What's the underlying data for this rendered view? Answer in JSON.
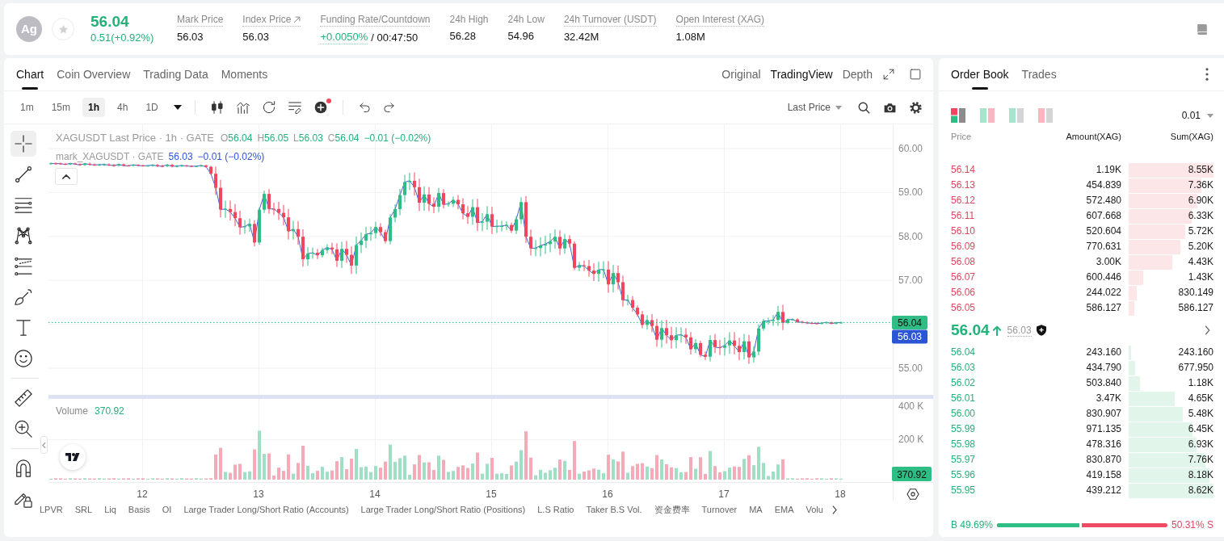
{
  "header": {
    "avatar": "Ag",
    "favorited": false,
    "last_price": "56.04",
    "change": "0.51(+0.92%)",
    "stats": [
      {
        "label": "Mark Price",
        "value": "56.03",
        "hint": true,
        "kind": "plain"
      },
      {
        "label": "Index Price",
        "value": "56.03",
        "hint": true,
        "kind": "link"
      },
      {
        "label": "Funding Rate/Countdown",
        "value": "+0.0050%",
        "extra": "/ 00:47:50",
        "hint": true,
        "kind": "funding"
      },
      {
        "label": "24h High",
        "value": "56.28",
        "hint": false,
        "kind": "plain"
      },
      {
        "label": "24h Low",
        "value": "54.96",
        "hint": false,
        "kind": "plain"
      },
      {
        "label": "24h Turnover (USDT)",
        "value": "32.42M",
        "hint": true,
        "kind": "plain"
      },
      {
        "label": "Open Interest (XAG)",
        "value": "1.08M",
        "hint": true,
        "kind": "plain"
      }
    ]
  },
  "chart_panel": {
    "tabs": [
      {
        "label": "Chart",
        "selected": true
      },
      {
        "label": "Coin Overview",
        "selected": false
      },
      {
        "label": "Trading Data",
        "selected": false
      },
      {
        "label": "Moments",
        "selected": false
      }
    ],
    "views": [
      {
        "label": "Original",
        "selected": false
      },
      {
        "label": "TradingView",
        "selected": true
      },
      {
        "label": "Depth",
        "selected": false
      }
    ],
    "intervals": [
      {
        "label": "1m",
        "selected": false
      },
      {
        "label": "15m",
        "selected": false
      },
      {
        "label": "1h",
        "selected": true
      },
      {
        "label": "4h",
        "selected": false
      },
      {
        "label": "1D",
        "selected": false
      }
    ],
    "indicator_dot": true,
    "price_source": "Last Price",
    "tool_groups": [
      {
        "tools": [
          {
            "kind": "crosshair",
            "selected": true
          },
          {
            "kind": "trend_line",
            "selected": false
          },
          {
            "kind": "parallel_lines",
            "selected": false
          },
          {
            "kind": "pattern",
            "selected": false
          },
          {
            "kind": "levels",
            "selected": false
          },
          {
            "kind": "brush",
            "selected": false
          },
          {
            "kind": "text",
            "selected": false
          },
          {
            "kind": "emoji",
            "selected": false
          }
        ]
      },
      {
        "tools": [
          {
            "kind": "ruler",
            "selected": false
          },
          {
            "kind": "zoom",
            "selected": false
          }
        ]
      },
      {
        "tools": [
          {
            "kind": "magnet",
            "selected": false
          },
          {
            "kind": "lock",
            "selected": false
          }
        ]
      }
    ],
    "legend": {
      "title": "XAGUSDT Last Price · 1h · GATE",
      "ohlc": [
        {
          "key": "O",
          "value": "56.04"
        },
        {
          "key": "H",
          "value": "56.05"
        },
        {
          "key": "L",
          "value": "56.03"
        },
        {
          "key": "C",
          "value": "56.04"
        }
      ],
      "change": "−0.01 (−0.02%)"
    },
    "mark_legend": {
      "title": "mark_XAGUSDT · GATE",
      "value": "56.03",
      "change": "−0.01 (−0.02%)"
    },
    "legend_expanded": true,
    "price_axis": [
      "60.00",
      "59.00",
      "58.00",
      "57.00",
      "55.00"
    ],
    "price_tags": [
      {
        "label": "56.04",
        "color": "#2ebd85"
      },
      {
        "label": "56.03",
        "color": "#2a55d5"
      }
    ],
    "volume_legend": {
      "title": "Volume",
      "value": "370.92"
    },
    "volume_axis": [
      "400 K",
      "200 K"
    ],
    "volume_tag": "370.92",
    "time_axis": [
      "12",
      "13",
      "14",
      "15",
      "16",
      "17",
      "18"
    ],
    "indicators": [
      "LPVR",
      "SRL",
      "Liq",
      "Basis",
      "OI",
      "Large Trader Long/Short Ratio (Accounts)",
      "Large Trader Long/Short Ratio (Positions)",
      "L.S Ratio",
      "Taker B.S Vol.",
      "资金费率",
      "Turnover",
      "MA",
      "EMA",
      "Volu"
    ]
  },
  "order_book": {
    "tabs": [
      {
        "label": "Order Book",
        "selected": true
      },
      {
        "label": "Trades",
        "selected": false
      }
    ],
    "layouts": [
      {
        "kind": "both",
        "selected": true
      },
      {
        "kind": "split",
        "selected": false
      },
      {
        "kind": "bids",
        "selected": false
      },
      {
        "kind": "asks",
        "selected": false
      }
    ],
    "precision": "0.01",
    "columns": [
      "Price",
      "Amount(XAG)",
      "Sum(XAG)"
    ],
    "asks": [
      {
        "price": "56.14",
        "amount": "1.19K",
        "sum": "8.55K"
      },
      {
        "price": "56.13",
        "amount": "454.839",
        "sum": "7.36K"
      },
      {
        "price": "56.12",
        "amount": "572.480",
        "sum": "6.90K"
      },
      {
        "price": "56.11",
        "amount": "607.668",
        "sum": "6.33K"
      },
      {
        "price": "56.10",
        "amount": "520.604",
        "sum": "5.72K"
      },
      {
        "price": "56.09",
        "amount": "770.631",
        "sum": "5.20K"
      },
      {
        "price": "56.08",
        "amount": "3.00K",
        "sum": "4.43K"
      },
      {
        "price": "56.07",
        "amount": "600.446",
        "sum": "1.43K"
      },
      {
        "price": "56.06",
        "amount": "244.022",
        "sum": "830.149"
      },
      {
        "price": "56.05",
        "amount": "586.127",
        "sum": "586.127"
      }
    ],
    "last": {
      "price": "56.04",
      "rising": true,
      "mark": "56.03"
    },
    "bids": [
      {
        "price": "56.04",
        "amount": "243.160",
        "sum": "243.160"
      },
      {
        "price": "56.03",
        "amount": "434.790",
        "sum": "677.950"
      },
      {
        "price": "56.02",
        "amount": "503.840",
        "sum": "1.18K"
      },
      {
        "price": "56.01",
        "amount": "3.47K",
        "sum": "4.65K"
      },
      {
        "price": "56.00",
        "amount": "830.907",
        "sum": "5.48K"
      },
      {
        "price": "55.99",
        "amount": "971.135",
        "sum": "6.45K"
      },
      {
        "price": "55.98",
        "amount": "478.316",
        "sum": "6.93K"
      },
      {
        "price": "55.97",
        "amount": "830.870",
        "sum": "7.76K"
      },
      {
        "price": "55.96",
        "amount": "419.158",
        "sum": "8.18K"
      },
      {
        "price": "55.95",
        "amount": "439.212",
        "sum": "8.62K"
      }
    ],
    "ratio": {
      "buy": "B 49.69%",
      "sell": "50.31% S",
      "level": 0.4969
    }
  }
}
